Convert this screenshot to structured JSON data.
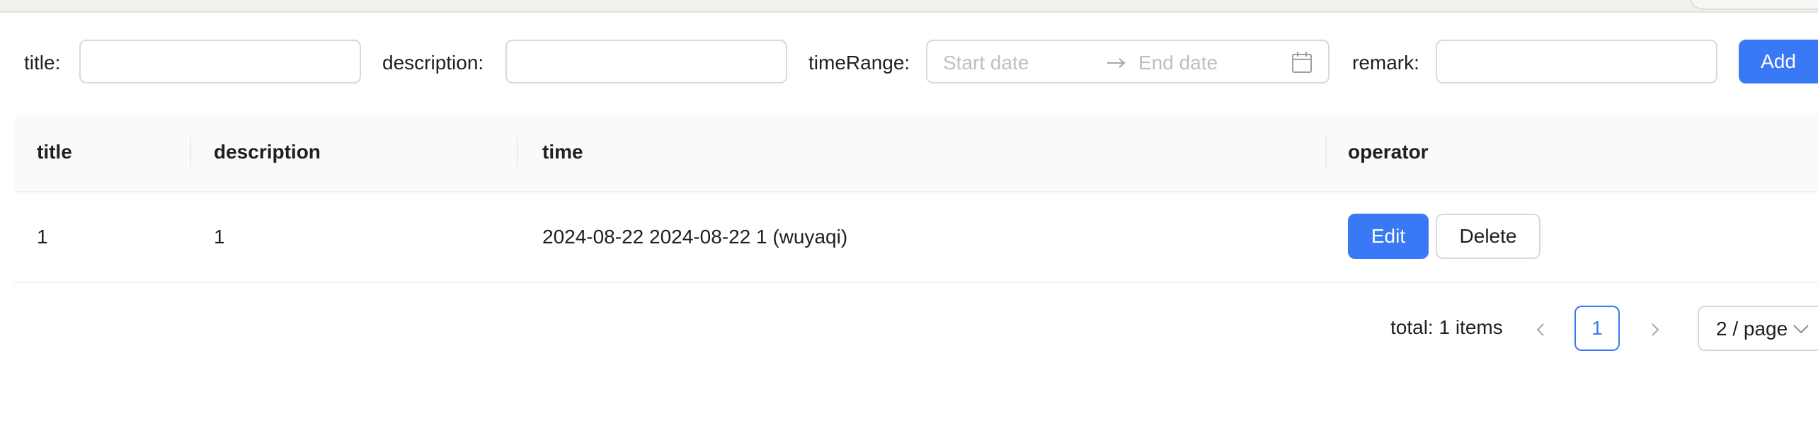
{
  "form": {
    "title_label": "title:",
    "title_value": "",
    "description_label": "description:",
    "description_value": "",
    "time_range_label": "timeRange:",
    "start_placeholder": "Start date",
    "end_placeholder": "End date",
    "remark_label": "remark:",
    "remark_value": "",
    "add_button": "Add"
  },
  "table": {
    "columns": [
      "title",
      "description",
      "time",
      "operator"
    ],
    "rows": [
      {
        "title": "1",
        "description": "1",
        "time": "2024-08-22 2024-08-22 1 (wuyaqi)",
        "edit_label": "Edit",
        "delete_label": "Delete"
      }
    ]
  },
  "pagination": {
    "total_text": "total: 1 items",
    "current_page": "1",
    "page_size": "2 / page"
  },
  "icons": {
    "range_separator": "arrow-right-icon",
    "date_picker": "calendar-icon",
    "prev_page": "chevron-left-icon",
    "next_page": "chevron-right-icon",
    "page_size_dropdown": "chevron-down-icon"
  },
  "colors": {
    "primary": "#3a79f5",
    "border": "#d9d9d9",
    "header_bg": "#fafafa",
    "placeholder": "#bfbfbf"
  }
}
